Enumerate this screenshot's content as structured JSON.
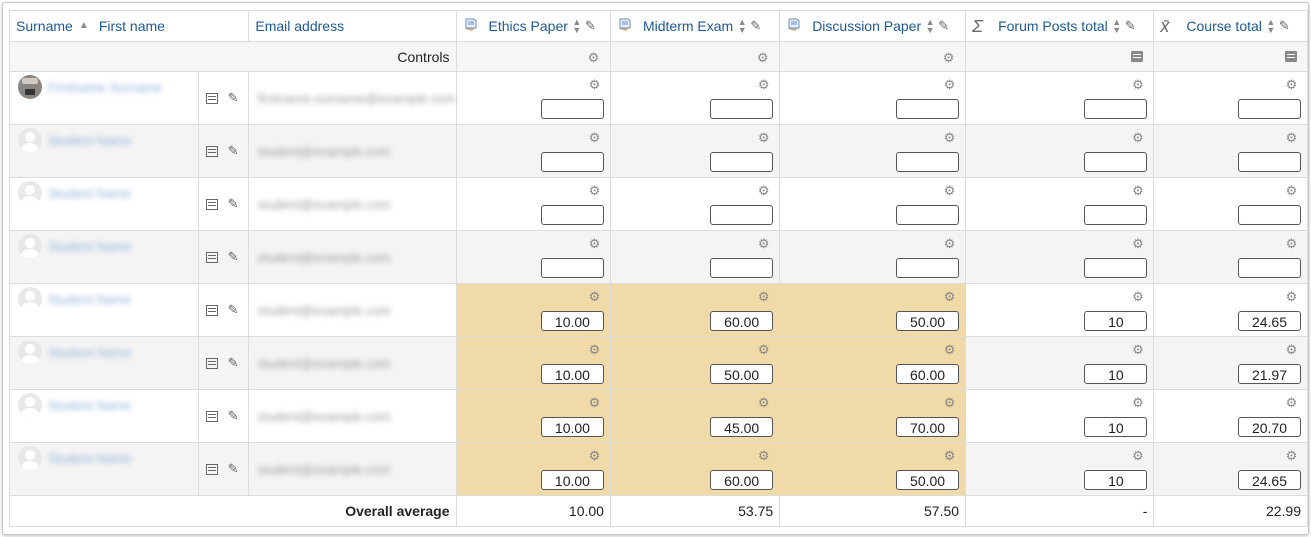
{
  "headers": {
    "surname": "Surname",
    "first_name": "First name",
    "email": "Email address",
    "items": [
      {
        "label": "Ethics Paper",
        "icon": "assignment-icon"
      },
      {
        "label": "Midterm Exam",
        "icon": "assignment-icon"
      },
      {
        "label": "Discussion Paper",
        "icon": "assignment-icon"
      },
      {
        "label": "Forum Posts total",
        "icon": "sigma-icon"
      },
      {
        "label": "Course total",
        "icon": "mean-icon"
      }
    ]
  },
  "controls_label": "Controls",
  "rows": [
    {
      "name": "Firstname Surname",
      "email": "firstname.surname@example.com",
      "avatar": "photo",
      "grades": [
        "",
        "",
        "",
        "",
        ""
      ],
      "highlight": false
    },
    {
      "name": "Student Name",
      "email": "student@example.com",
      "avatar": "default",
      "grades": [
        "",
        "",
        "",
        "",
        ""
      ],
      "highlight": false
    },
    {
      "name": "Student Name",
      "email": "student@example.com",
      "avatar": "default",
      "grades": [
        "",
        "",
        "",
        "",
        ""
      ],
      "highlight": false
    },
    {
      "name": "Student Name",
      "email": "student@example.com",
      "avatar": "default",
      "grades": [
        "",
        "",
        "",
        "",
        ""
      ],
      "highlight": false
    },
    {
      "name": "Student Name",
      "email": "student@example.com",
      "avatar": "default",
      "grades": [
        "10.00",
        "60.00",
        "50.00",
        "10",
        "24.65"
      ],
      "highlight": true
    },
    {
      "name": "Student Name",
      "email": "student@example.com",
      "avatar": "default",
      "grades": [
        "10.00",
        "50.00",
        "60.00",
        "10",
        "21.97"
      ],
      "highlight": true
    },
    {
      "name": "Student Name",
      "email": "student@example.com",
      "avatar": "default",
      "grades": [
        "10.00",
        "45.00",
        "70.00",
        "10",
        "20.70"
      ],
      "highlight": true
    },
    {
      "name": "Student Name",
      "email": "student@example.com",
      "avatar": "default",
      "grades": [
        "10.00",
        "60.00",
        "50.00",
        "10",
        "24.65"
      ],
      "highlight": true
    }
  ],
  "average": {
    "label": "Overall average",
    "values": [
      "10.00",
      "53.75",
      "57.50",
      "-",
      "22.99"
    ]
  },
  "colors": {
    "link": "#1d5a96",
    "highlight": "#efdaa8"
  }
}
